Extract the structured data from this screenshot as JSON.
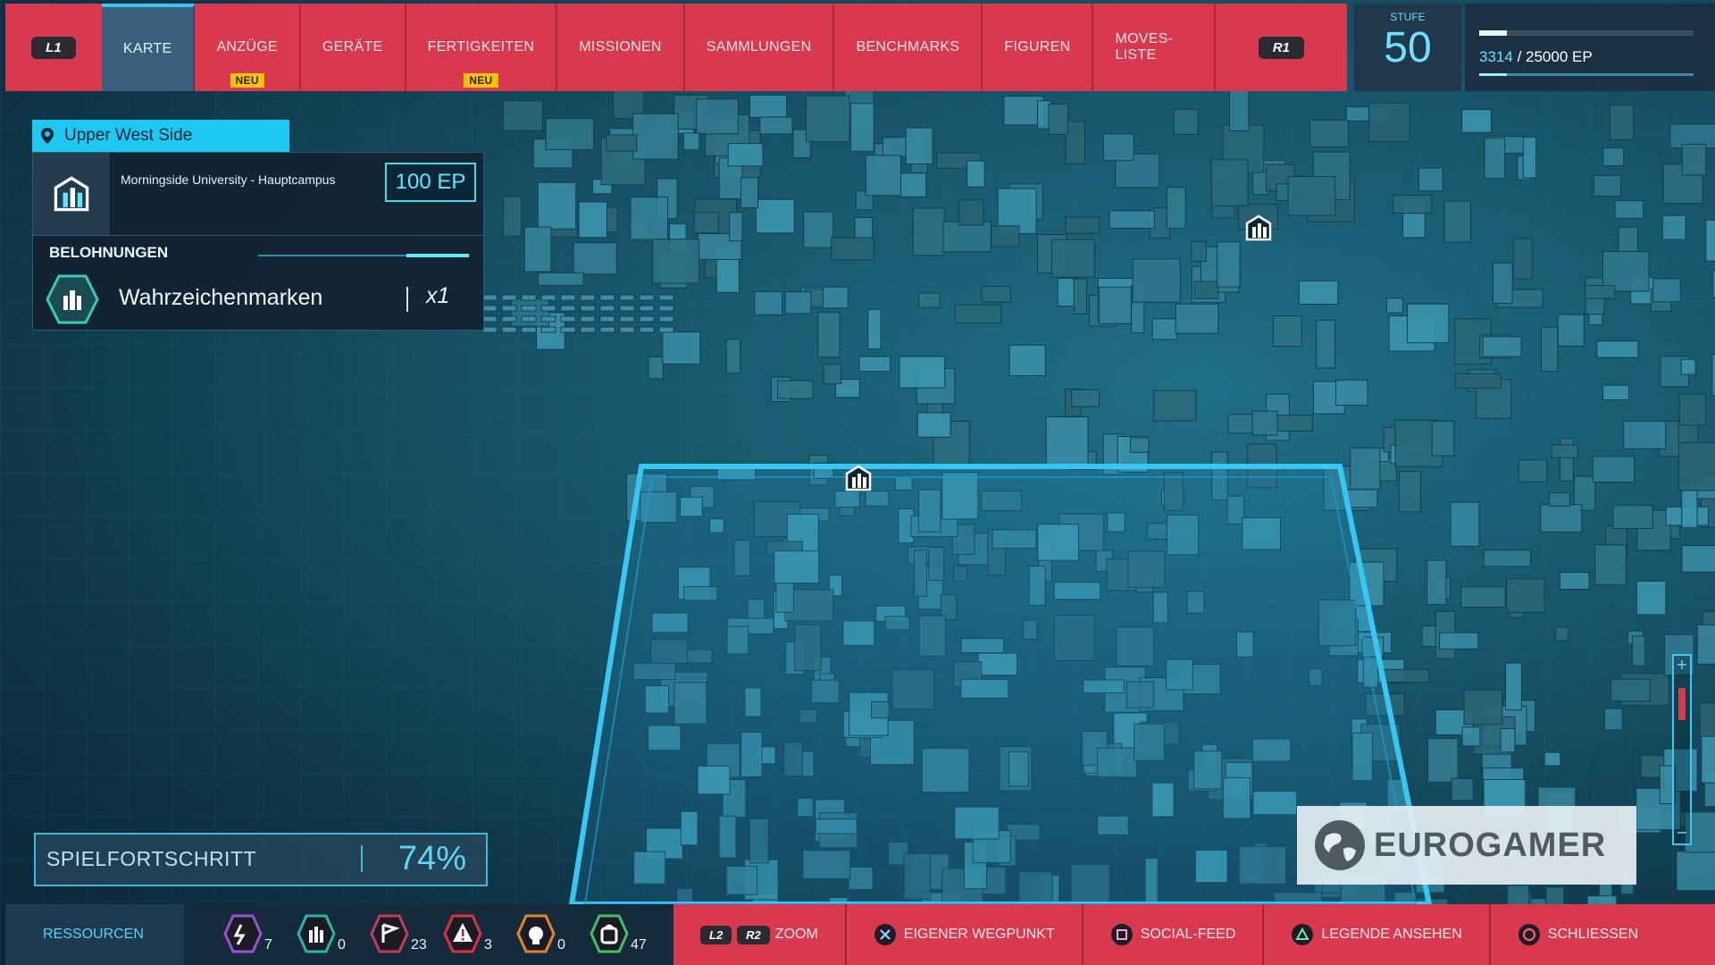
{
  "nav": {
    "left_shoulder": "L1",
    "right_shoulder": "R1",
    "tabs": [
      {
        "label": "KARTE",
        "active": true,
        "badge": ""
      },
      {
        "label": "ANZÜGE",
        "active": false,
        "badge": "NEU"
      },
      {
        "label": "GERÄTE",
        "active": false,
        "badge": ""
      },
      {
        "label": "FERTIGKEITEN",
        "active": false,
        "badge": "NEU"
      },
      {
        "label": "MISSIONEN",
        "active": false,
        "badge": ""
      },
      {
        "label": "SAMMLUNGEN",
        "active": false,
        "badge": ""
      },
      {
        "label": "BENCHMARKS",
        "active": false,
        "badge": ""
      },
      {
        "label": "FIGUREN",
        "active": false,
        "badge": ""
      },
      {
        "label": "MOVES-LISTE",
        "active": false,
        "badge": ""
      }
    ]
  },
  "level": {
    "label": "STUFE",
    "value": "50",
    "xp_current": "3314",
    "xp_total": "/ 25000 EP",
    "xp_fraction": 0.13
  },
  "location": {
    "district": "Upper West Side",
    "landmark_name": "Morningside University - Hauptcampus",
    "ep_reward": "100 EP",
    "rewards_title": "BELOHNUNGEN",
    "reward_label": "Wahrzeichenmarken",
    "reward_qty": "x1"
  },
  "progress": {
    "label": "SPIELFORTSCHRITT",
    "value": "74%"
  },
  "watermark": "EUROGAMER",
  "resources": {
    "label": "RESSOURCEN",
    "items": [
      {
        "icon": "research-token-icon",
        "color": "#9b4fd6",
        "count": "7"
      },
      {
        "icon": "landmark-token-icon",
        "color": "#2bb3a6",
        "count": "0"
      },
      {
        "icon": "base-token-icon",
        "color": "#c43a5a",
        "count": "23"
      },
      {
        "icon": "crime-token-icon",
        "color": "#e0303f",
        "count": "3"
      },
      {
        "icon": "challenge-token-icon",
        "color": "#e0862a",
        "count": "0"
      },
      {
        "icon": "backpack-token-icon",
        "color": "#3fc066",
        "count": "47"
      }
    ]
  },
  "controls": {
    "zoom_l2": "L2",
    "zoom_r2": "R2",
    "zoom": "ZOOM",
    "waypoint": "EIGENER WEGPUNKT",
    "social": "SOCIAL-FEED",
    "legend": "LEGENDE ANSEHEN",
    "close": "SCHLIESSEN"
  },
  "colors": {
    "accent": "#d8394f",
    "cyan": "#1ec8f3",
    "panel": "#122230"
  }
}
